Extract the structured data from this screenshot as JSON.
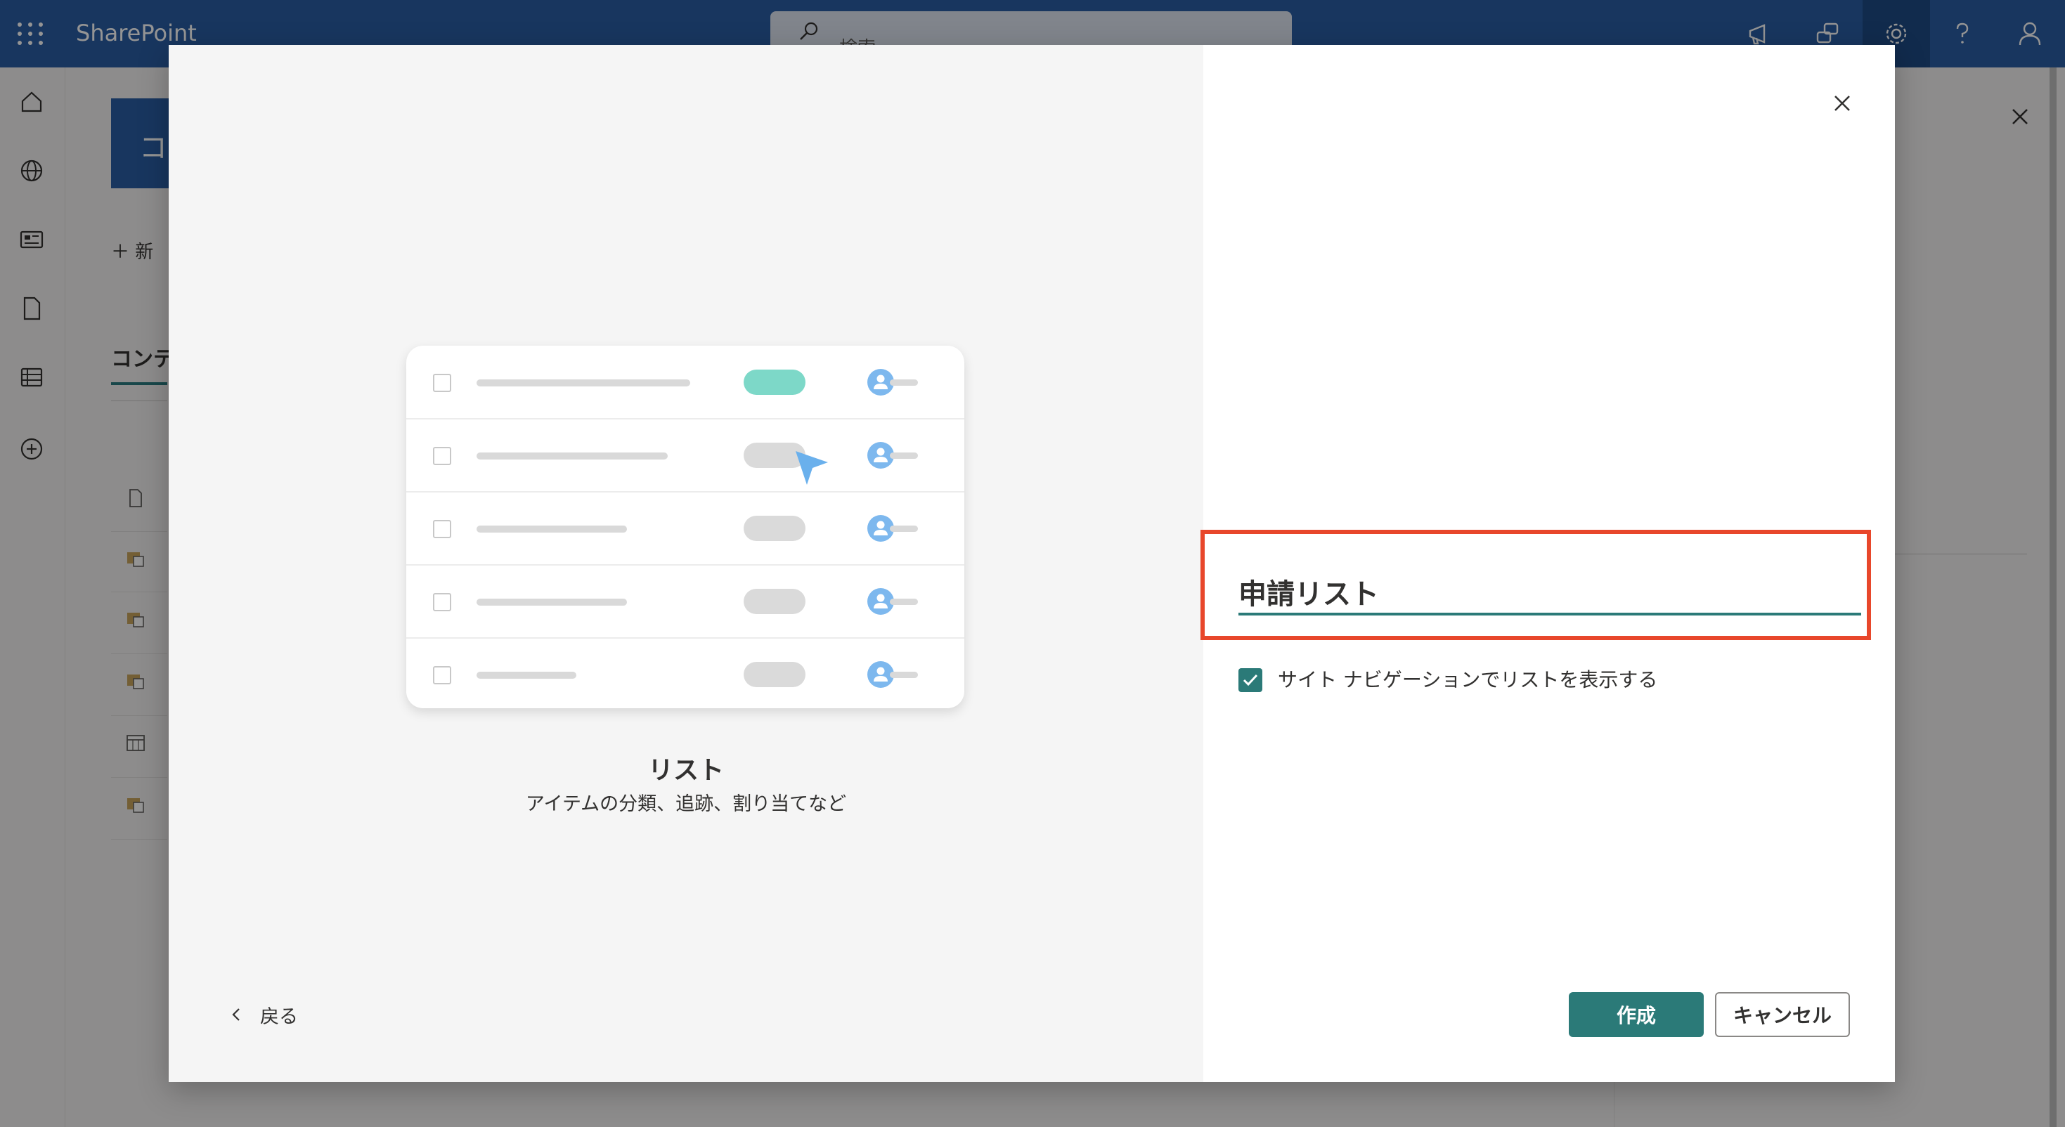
{
  "suitebar": {
    "app_name": "SharePoint",
    "search_placeholder": "検索",
    "icons": [
      "waffle-icon",
      "megaphone-icon",
      "chat-icon",
      "gear-icon",
      "help-icon",
      "person-icon"
    ]
  },
  "rail": {
    "icons": [
      "home-icon",
      "globe-icon",
      "news-icon",
      "document-icon",
      "list-icon",
      "add-circle-icon"
    ]
  },
  "background_page": {
    "hero_initial": "コ",
    "new_button": "＋ 新",
    "content_heading": "コンテ"
  },
  "dialog": {
    "template": {
      "title": "リスト",
      "description": "アイテムの分類、追跡、割り当てなど"
    },
    "back_label": "戻る",
    "name_field_value": "申請リスト",
    "show_in_nav_label": "サイト ナビゲーションでリストを表示する",
    "show_in_nav_checked": true,
    "create_label": "作成",
    "cancel_label": "キャンセル"
  },
  "colors": {
    "suitebar": "#2a5ea4",
    "accent_teal": "#2b7a78",
    "highlight_red": "#e8472b"
  }
}
